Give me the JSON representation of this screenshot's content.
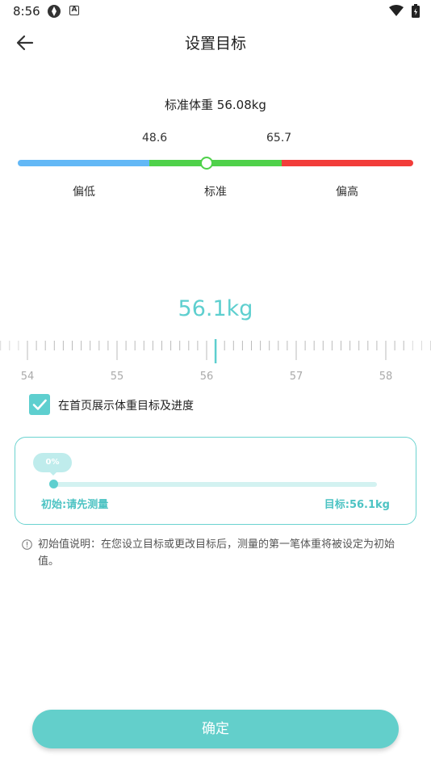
{
  "status_bar": {
    "time": "8:56"
  },
  "header": {
    "title": "设置目标",
    "back_icon": "arrow-left-icon"
  },
  "standard": {
    "label": "标准体重 56.08kg",
    "low_threshold": "48.6",
    "high_threshold": "65.7",
    "ranges": [
      "偏低",
      "标准",
      "偏高"
    ],
    "colors": {
      "low": "#63b8f6",
      "normal": "#4fd14a",
      "high": "#f23d3a"
    },
    "current_position": 0.47
  },
  "target": {
    "value": "56.1kg",
    "ruler_ticks": [
      "54",
      "55",
      "56",
      "57",
      "58"
    ],
    "ruler_value": 56.1
  },
  "show_on_home": {
    "label": "在首页展示体重目标及进度",
    "checked": true
  },
  "progress": {
    "percent_label": "0%",
    "percent": 0,
    "start_label": "初始:请先测量",
    "goal_label": "目标:56.1kg"
  },
  "note": {
    "icon": "info-icon",
    "text": "初始值说明：在您设立目标或更改目标后，测量的第一笔体重将被设定为初始值。"
  },
  "confirm_label": "确定",
  "accent_color": "#5ecfcf"
}
